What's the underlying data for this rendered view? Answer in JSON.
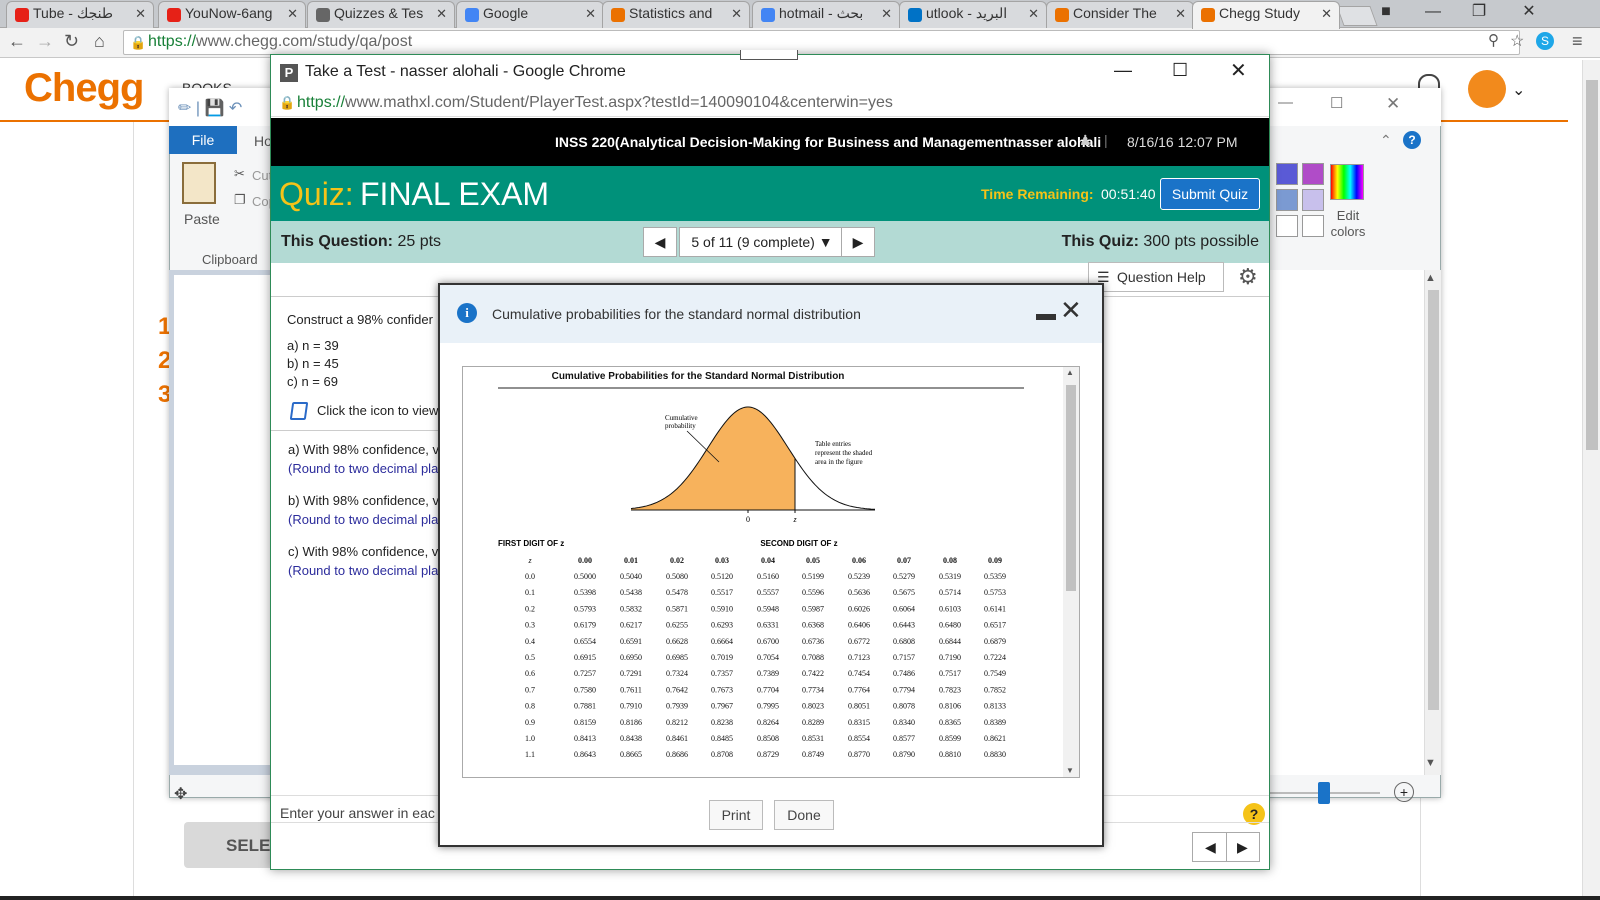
{
  "browser": {
    "tabs": [
      {
        "label": "Tube - طنجك",
        "icon": "youtube-icon",
        "color": "#e62117"
      },
      {
        "label": "YouNow-6ang",
        "icon": "youtube-icon",
        "color": "#e62117"
      },
      {
        "label": "Quizzes & Tes",
        "icon": "document-icon",
        "color": "#666666"
      },
      {
        "label": "Google",
        "icon": "google-icon",
        "color": "#4285f4"
      },
      {
        "label": "Statistics and",
        "icon": "chegg-icon",
        "color": "#eb7100"
      },
      {
        "label": "hotmail - بحث",
        "icon": "google-icon",
        "color": "#4285f4"
      },
      {
        "label": "utlook - البريد",
        "icon": "mail-icon",
        "color": "#0072c6"
      },
      {
        "label": "Consider The",
        "icon": "chegg-icon",
        "color": "#eb7100"
      },
      {
        "label": "Chegg Study",
        "icon": "chegg-icon",
        "color": "#eb7100"
      }
    ],
    "url_https": "https://",
    "url_rest": "www.chegg.com/study/qa/post"
  },
  "chegg": {
    "logo": "Chegg",
    "nav_partial": "BOOKS",
    "select_btn": "SELEC"
  },
  "paint": {
    "file_tab": "File",
    "home_tab": "Ho",
    "paste": "Paste",
    "cut": "Cut",
    "copy": "Cop",
    "clipboard": "Clipboard",
    "edit_colors": "Edit colors"
  },
  "popup": {
    "title": "Take a Test - nasser alohali - Google Chrome",
    "url_https": "https://",
    "url_rest": "www.mathxl.com/Student/PlayerTest.aspx?testId=140090104&centerwin=yes",
    "course": "INSS 220(Analytical Decision-Making for Business and Managementnasser alohali",
    "date": "8/16/16 12:07 PM",
    "quiz_label": "Quiz:",
    "quiz_title": "FINAL EXAM",
    "time_label": "Time Remaining:",
    "time_value": "00:51:40",
    "submit": "Submit Quiz",
    "this_question_label": "This Question:",
    "this_question_value": "25 pts",
    "question_nav": "5 of 11 (9 complete)",
    "this_quiz_label": "This Quiz:",
    "this_quiz_value": "300 pts possible",
    "question_help": "Question Help",
    "q_intro": "Construct a 98% confider",
    "q_a": "a) n = 39",
    "q_b": "b) n = 45",
    "q_c": "c) n = 69",
    "q_icon_text": "Click the icon to view",
    "ans_a": "a) With 98% confidence, v",
    "ans_b": "b) With 98% confidence, v",
    "ans_c": "c) With 98% confidence, v",
    "round": "(Round to two decimal pla",
    "enter_answer": "Enter your answer in eac"
  },
  "modal": {
    "title": "Cumulative probabilities for the standard normal distribution",
    "print": "Print",
    "done": "Done"
  },
  "table": {
    "title": "Cumulative Probabilities for the Standard Normal Distribution",
    "cum_label_1": "Cumulative",
    "cum_label_2": "probability",
    "entries_1": "Table entries",
    "entries_2": "represent the shaded",
    "entries_3": "area in the figure",
    "axis_0": "0",
    "axis_z": "z",
    "first_digit": "FIRST DIGIT OF z",
    "second_digit": "SECOND DIGIT OF z",
    "columns": [
      "z",
      "0.00",
      "0.01",
      "0.02",
      "0.03",
      "0.04",
      "0.05",
      "0.06",
      "0.07",
      "0.08",
      "0.09"
    ],
    "rows": [
      [
        "0.0",
        "0.5000",
        "0.5040",
        "0.5080",
        "0.5120",
        "0.5160",
        "0.5199",
        "0.5239",
        "0.5279",
        "0.5319",
        "0.5359"
      ],
      [
        "0.1",
        "0.5398",
        "0.5438",
        "0.5478",
        "0.5517",
        "0.5557",
        "0.5596",
        "0.5636",
        "0.5675",
        "0.5714",
        "0.5753"
      ],
      [
        "0.2",
        "0.5793",
        "0.5832",
        "0.5871",
        "0.5910",
        "0.5948",
        "0.5987",
        "0.6026",
        "0.6064",
        "0.6103",
        "0.6141"
      ],
      [
        "0.3",
        "0.6179",
        "0.6217",
        "0.6255",
        "0.6293",
        "0.6331",
        "0.6368",
        "0.6406",
        "0.6443",
        "0.6480",
        "0.6517"
      ],
      [
        "0.4",
        "0.6554",
        "0.6591",
        "0.6628",
        "0.6664",
        "0.6700",
        "0.6736",
        "0.6772",
        "0.6808",
        "0.6844",
        "0.6879"
      ],
      [
        "0.5",
        "0.6915",
        "0.6950",
        "0.6985",
        "0.7019",
        "0.7054",
        "0.7088",
        "0.7123",
        "0.7157",
        "0.7190",
        "0.7224"
      ],
      [
        "0.6",
        "0.7257",
        "0.7291",
        "0.7324",
        "0.7357",
        "0.7389",
        "0.7422",
        "0.7454",
        "0.7486",
        "0.7517",
        "0.7549"
      ],
      [
        "0.7",
        "0.7580",
        "0.7611",
        "0.7642",
        "0.7673",
        "0.7704",
        "0.7734",
        "0.7764",
        "0.7794",
        "0.7823",
        "0.7852"
      ],
      [
        "0.8",
        "0.7881",
        "0.7910",
        "0.7939",
        "0.7967",
        "0.7995",
        "0.8023",
        "0.8051",
        "0.8078",
        "0.8106",
        "0.8133"
      ],
      [
        "0.9",
        "0.8159",
        "0.8186",
        "0.8212",
        "0.8238",
        "0.8264",
        "0.8289",
        "0.8315",
        "0.8340",
        "0.8365",
        "0.8389"
      ],
      [
        "1.0",
        "0.8413",
        "0.8438",
        "0.8461",
        "0.8485",
        "0.8508",
        "0.8531",
        "0.8554",
        "0.8577",
        "0.8599",
        "0.8621"
      ],
      [
        "1.1",
        "0.8643",
        "0.8665",
        "0.8686",
        "0.8708",
        "0.8729",
        "0.8749",
        "0.8770",
        "0.8790",
        "0.8810",
        "0.8830"
      ]
    ]
  },
  "colors": {
    "chegg_orange": "#eb7100",
    "mathxl_teal": "#00917a",
    "quiz_yellow": "#f5c318",
    "submit_blue": "#1a73c8",
    "curve_fill": "#f7b25c"
  }
}
